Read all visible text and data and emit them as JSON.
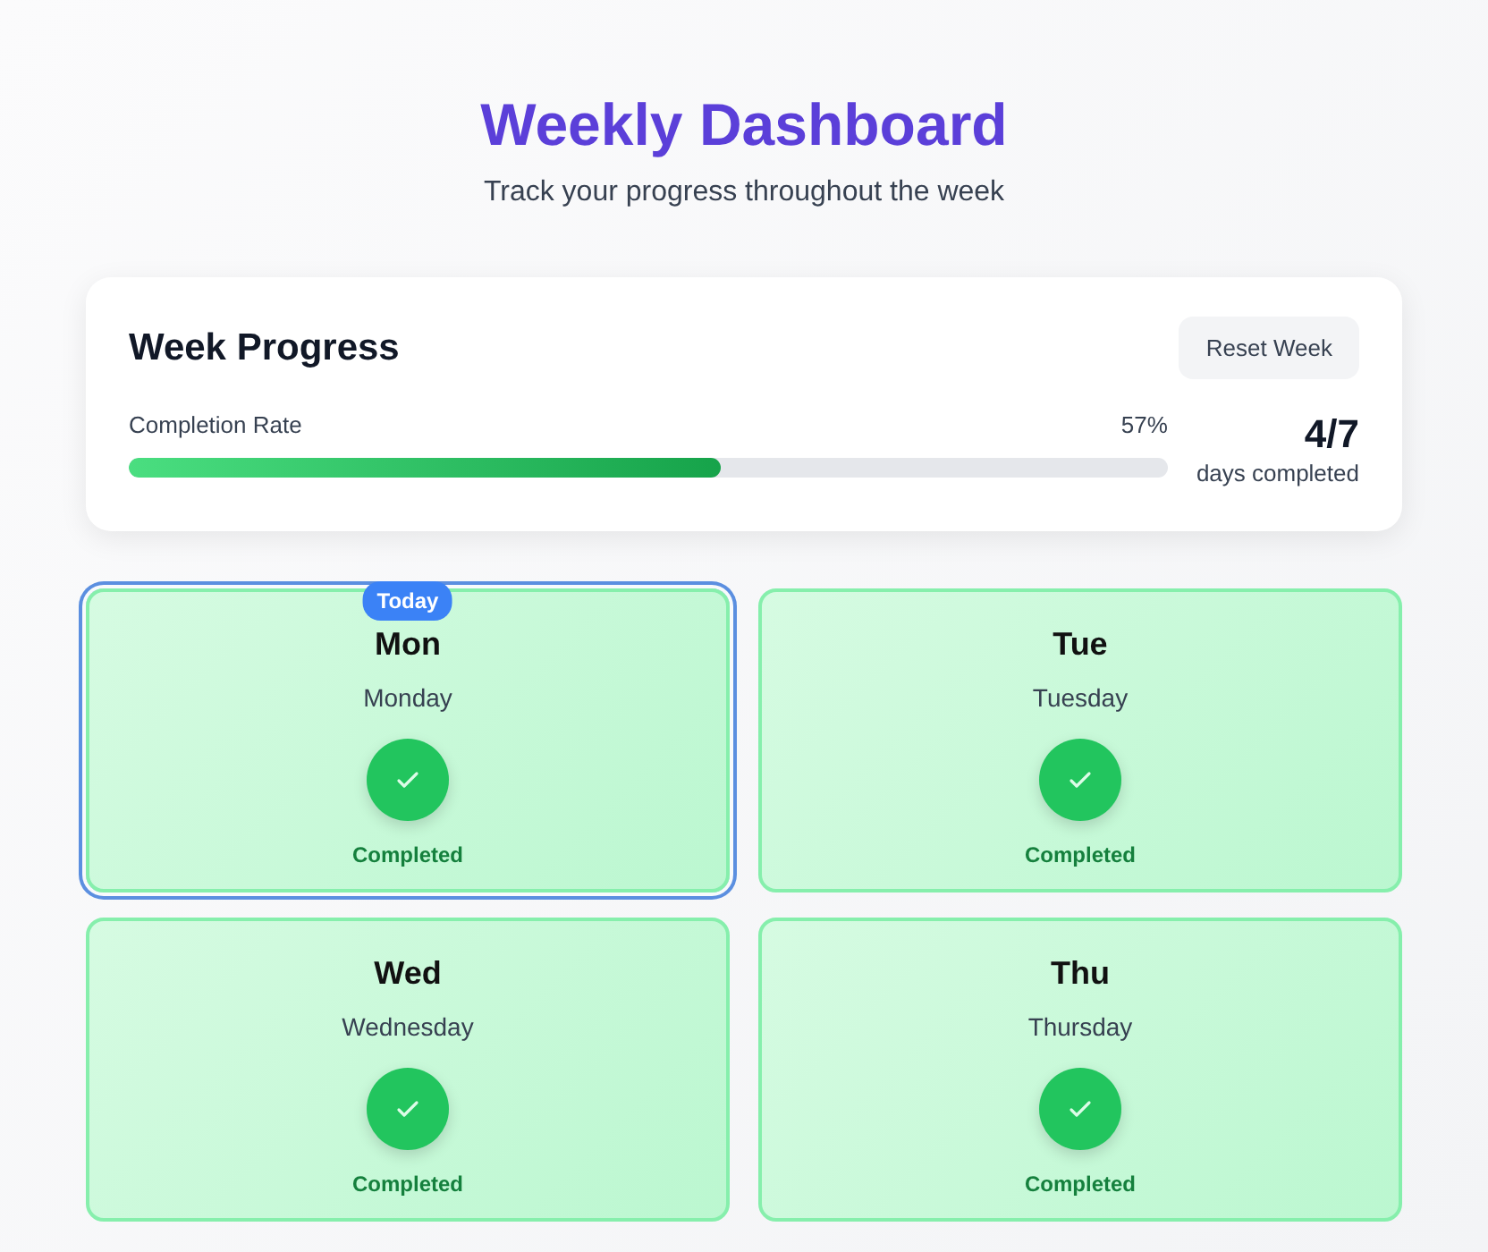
{
  "header": {
    "title": "Weekly Dashboard",
    "subtitle": "Track your progress throughout the week"
  },
  "progress": {
    "title": "Week Progress",
    "reset_button": "Reset Week",
    "label": "Completion Rate",
    "percent": "57%",
    "level": 0.57,
    "count": "4/7",
    "count_label": "days completed"
  },
  "days": [
    {
      "short": "Mon",
      "full": "Monday",
      "status": "Completed",
      "completed": true,
      "today": true,
      "badge": "Today"
    },
    {
      "short": "Tue",
      "full": "Tuesday",
      "status": "Completed",
      "completed": true,
      "today": false
    },
    {
      "short": "Wed",
      "full": "Wednesday",
      "status": "Completed",
      "completed": true,
      "today": false
    },
    {
      "short": "Thu",
      "full": "Thursday",
      "status": "Completed",
      "completed": true,
      "today": false
    }
  ]
}
